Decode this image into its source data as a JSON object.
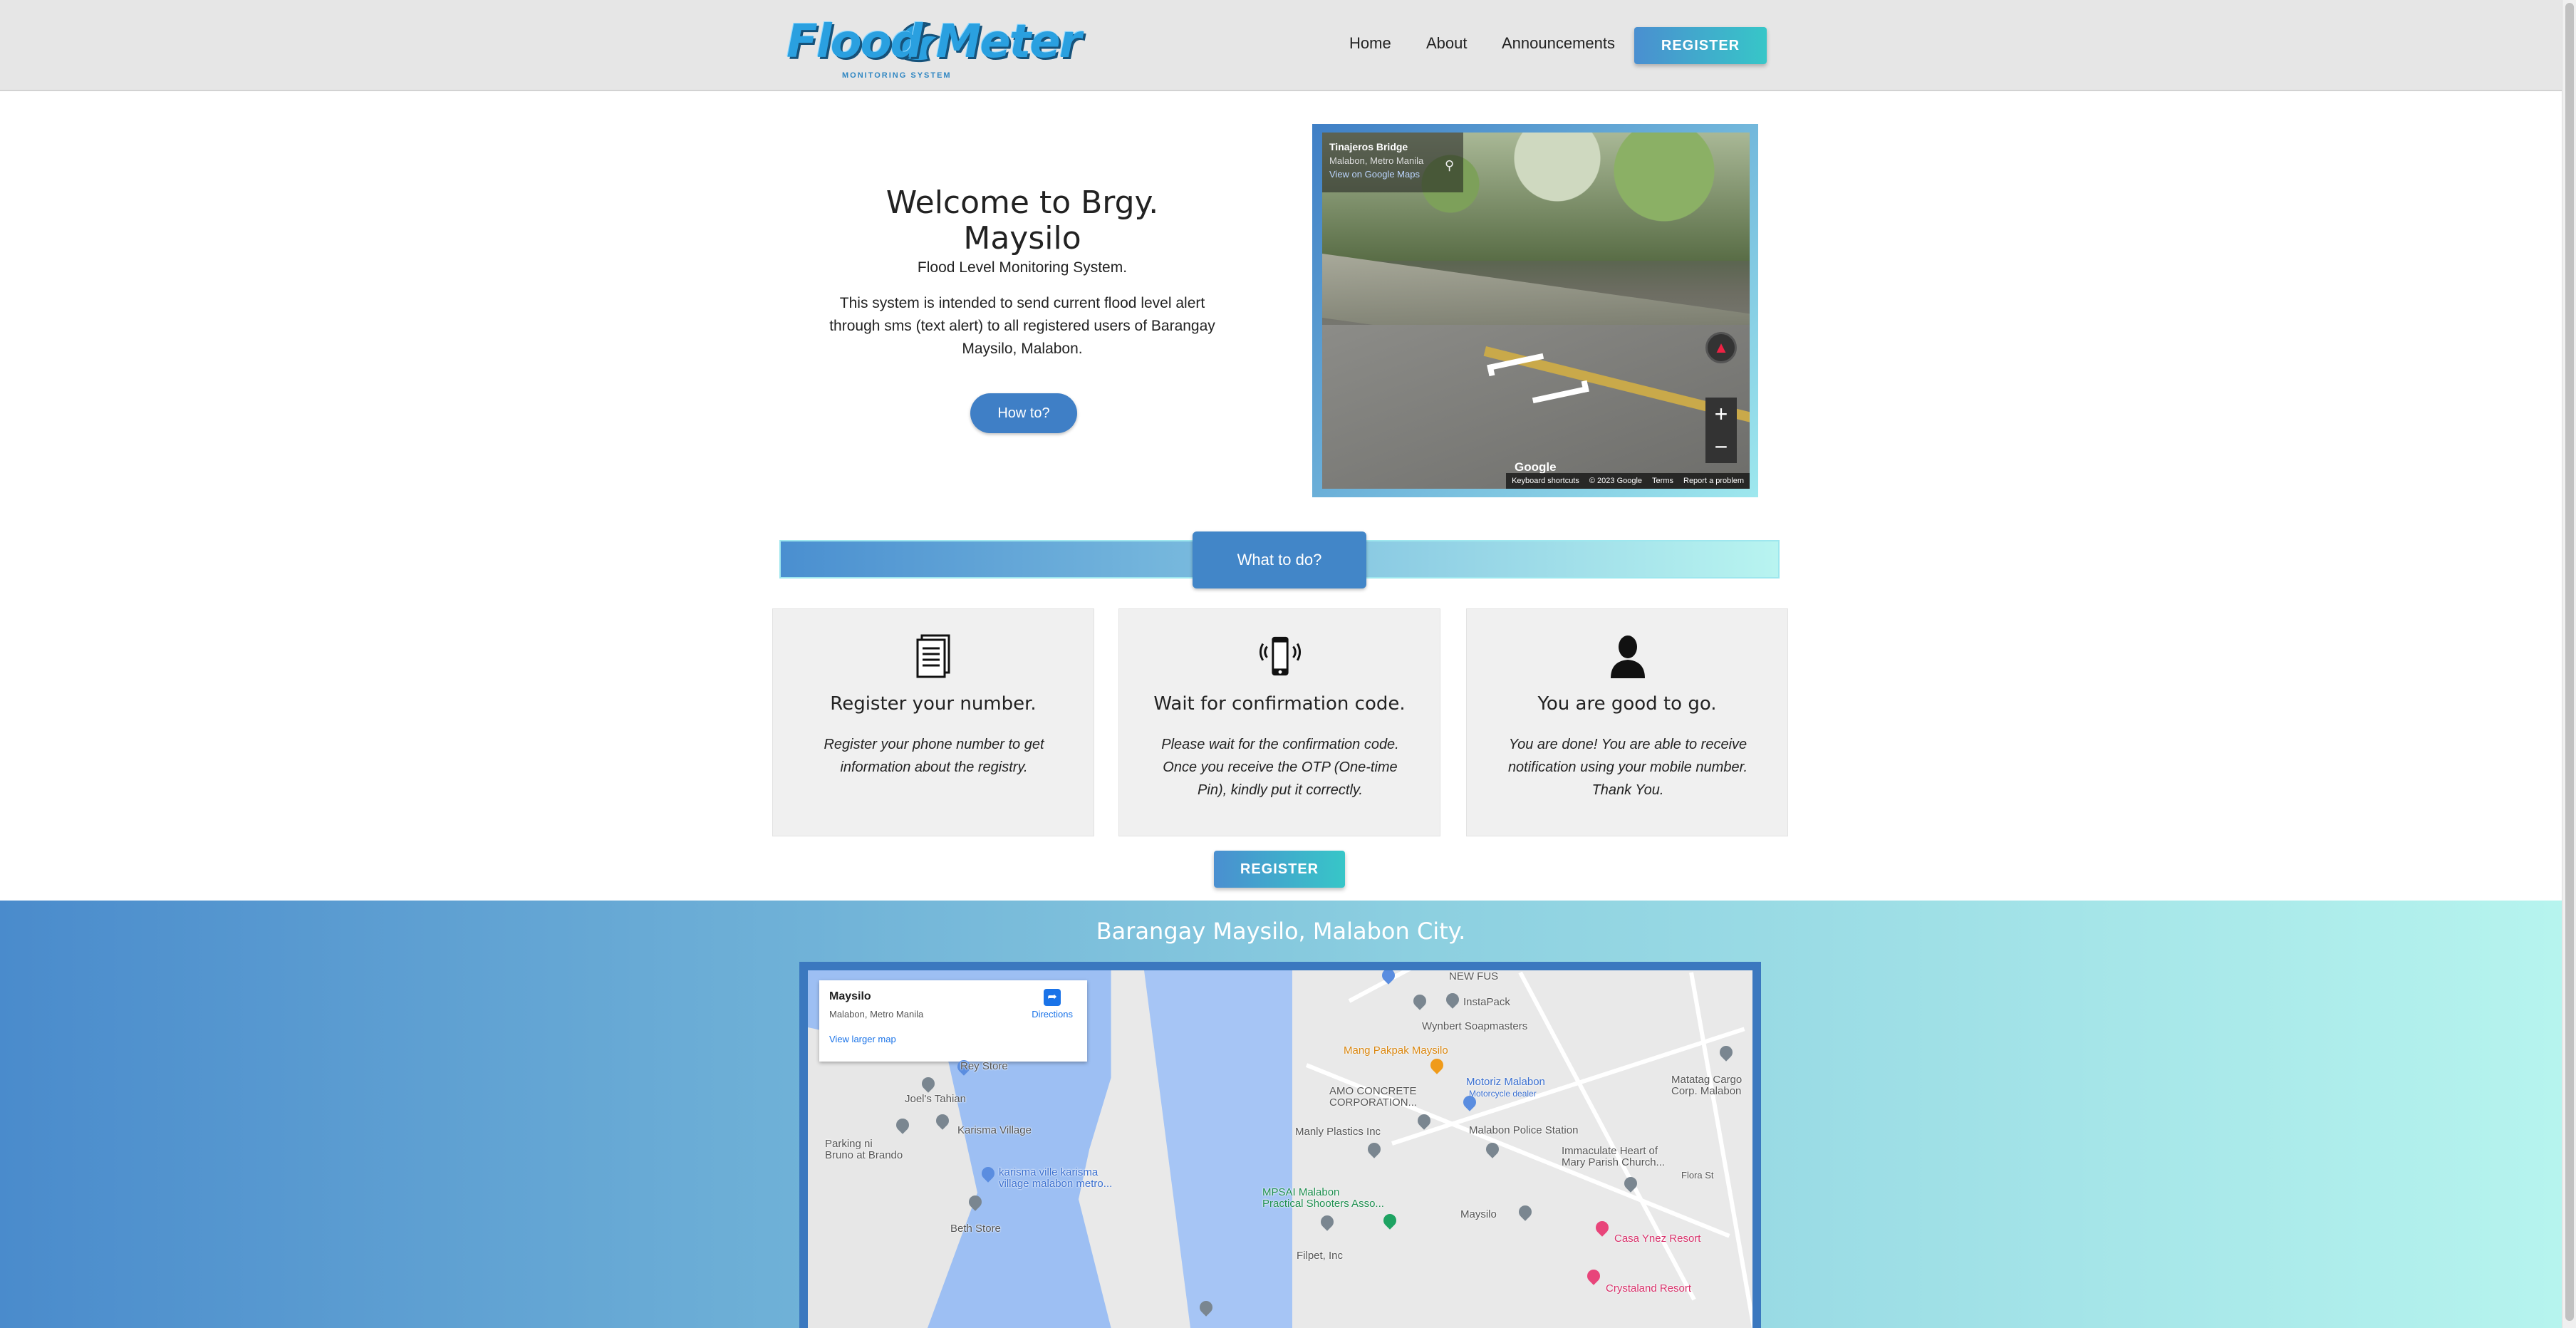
{
  "header": {
    "logo_text": "Flood Meter",
    "logo_sub": "MONITORING SYSTEM",
    "nav": [
      "Home",
      "About",
      "Announcements"
    ],
    "register_label": "REGISTER"
  },
  "hero": {
    "title": "Welcome to Brgy. Maysilo",
    "subtitle": "Flood Level Monitoring System.",
    "description": "This system is intended to send current flood level alert through sms (text alert) to all registered users of Barangay Maysilo, Malabon.",
    "howto_label": "How to?"
  },
  "streetview": {
    "place": "Tinajeros Bridge",
    "location": "Malabon, Metro Manila",
    "view_link": "View on Google Maps",
    "google": "Google",
    "footer": [
      "Keyboard shortcuts",
      "© 2023 Google",
      "Terms",
      "Report a problem"
    ]
  },
  "whatodo": {
    "label": "What to do?"
  },
  "steps": [
    {
      "icon": "document-icon",
      "title": "Register your number.",
      "text": "Register your phone number to get information about the registry."
    },
    {
      "icon": "phone-vibrate-icon",
      "title": "Wait for confirmation code.",
      "text": "Please wait for the confirmation code. Once you receive the OTP (One-time Pin), kindly put it correctly."
    },
    {
      "icon": "user-icon",
      "title": "You are good to go.",
      "text": "You are done! You are able to receive notification using your mobile number. Thank You."
    }
  ],
  "register_label": "REGISTER",
  "map": {
    "heading": "Barangay Maysilo, Malabon City.",
    "card_title": "Maysilo",
    "card_sub": "Malabon, Metro Manila",
    "card_link": "View larger map",
    "directions": "Directions",
    "labels": {
      "rey_store": "Rey Store",
      "joels_tahian": "Joel's Tahian",
      "karisma_village": "Karisma Village",
      "parking": "Parking ni\nBruno at Brando",
      "karisma_ville": "karisma ville karisma\nvillage malabon metro...",
      "beth_store": "Beth Store",
      "new_fus": "NEW FUS",
      "instapack": "InstaPack",
      "wynbert": "Wynbert Soapmasters",
      "mang_pakpak": "Mang Pakpak Maysilo",
      "motoriz": "Motoriz Malabon",
      "motoriz_sub": "Motorcycle dealer",
      "amo": "AMO CONCRETE\nCORPORATION...",
      "matatag": "Matatag Cargo\nCorp. Malabon",
      "manly": "Manly Plastics Inc",
      "police": "Malabon Police Station",
      "immaculate": "Immaculate Heart of\nMary Parish Church...",
      "flora": "Flora St",
      "mpsai": "MPSAI Malabon\nPractical Shooters Asso...",
      "maysilo": "Maysilo",
      "casa_ynez": "Casa Ynez Resort",
      "filpet": "Filpet, Inc",
      "crystaland": "Crystaland Resort"
    }
  }
}
